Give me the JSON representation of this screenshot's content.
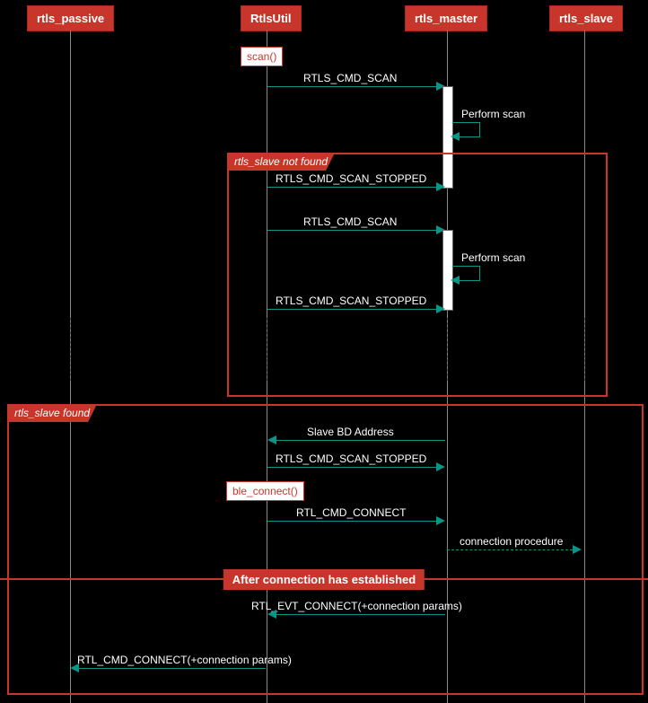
{
  "participants": {
    "passive": "rtls_passive",
    "util": "RtlsUtil",
    "master": "rtls_master",
    "slave": "rtls_slave"
  },
  "notes": {
    "scan": "scan()",
    "ble_connect": "ble_connect()"
  },
  "messages": {
    "rtls_scan1": "RTLS_CMD_SCAN",
    "perform_scan1": "Perform scan",
    "scan_stopped1": "RTLS_CMD_SCAN_STOPPED",
    "rtls_scan2": "RTLS_CMD_SCAN",
    "perform_scan2": "Perform scan",
    "scan_stopped2": "RTLS_CMD_SCAN_STOPPED",
    "slave_bd_addr": "Slave BD Address",
    "scan_stopped3": "RTLS_CMD_SCAN_STOPPED",
    "connect_cmd": "RTL_CMD_CONNECT",
    "connection_proc": "connection procedure",
    "connect_evt": "RTL_EVT_CONNECT(+connection params)",
    "connect_params": "RTL_CMD_CONNECT(+connection params)"
  },
  "groups": {
    "not_found": "rtls_slave not found",
    "found": "rtls_slave found"
  },
  "divider": "After connection has established"
}
